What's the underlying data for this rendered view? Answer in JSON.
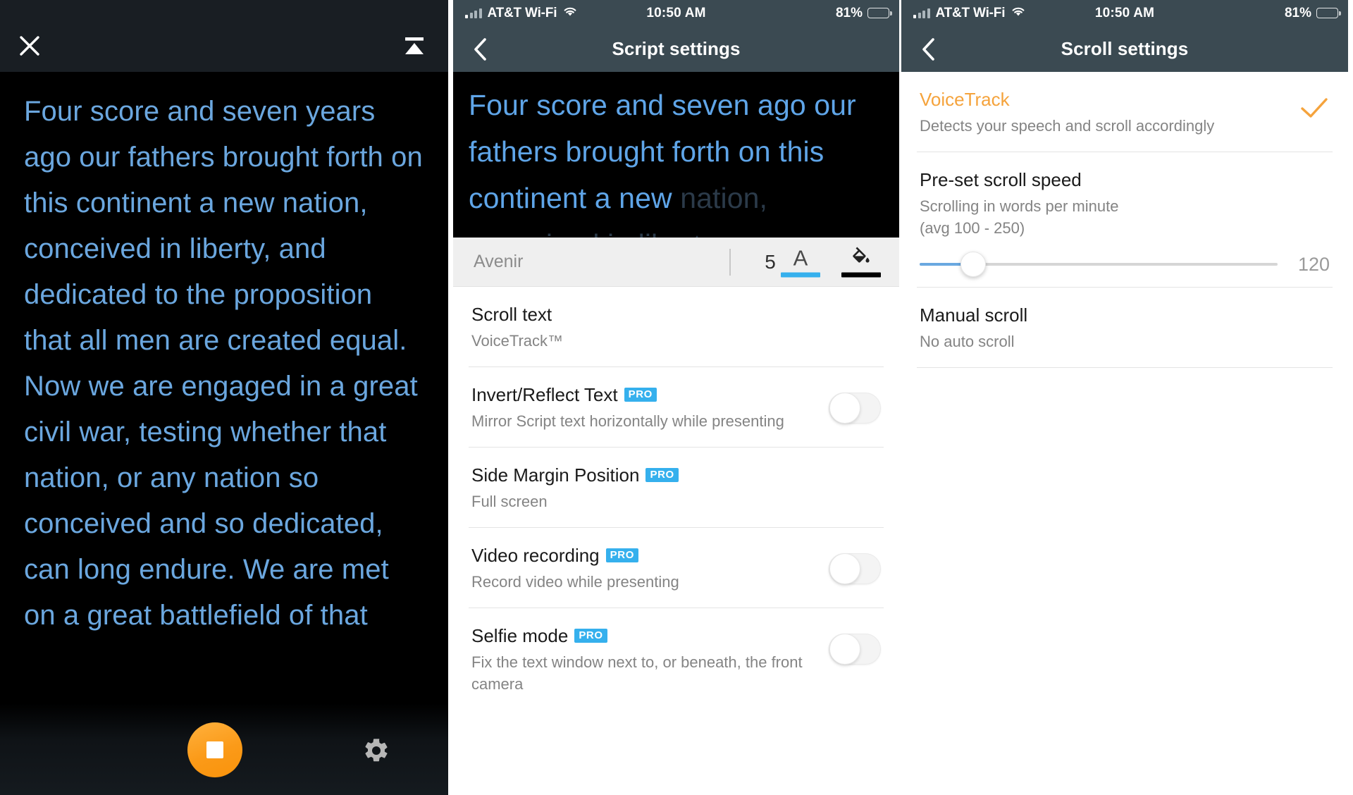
{
  "panel_teleprompter": {
    "name": "Teleprompter presenting view",
    "close_icon": "close-icon",
    "eject_icon": "eject-icon",
    "script_text": "Four score and seven years ago our fathers brought forth on this continent a new nation, conceived in liberty, and dedicated to the proposition that all men are created equal. Now we are engaged in a great civil war, testing whether that nation, or any nation so conceived and so dedicated, can long endure. We are met on a great battlefield of that",
    "record_button_label": "",
    "record_icon": "stop-square-icon",
    "settings_icon": "gear-icon",
    "accent_color": "#fb9a18",
    "text_color": "#6ba7df",
    "background_color": "#000000"
  },
  "statusbar": {
    "carrier": "AT&T Wi-Fi",
    "wifi_icon": "wifi-icon",
    "signal_icon": "signal-bars-icon",
    "time": "10:50 AM",
    "battery_percent": "81%",
    "battery_icon": "battery-icon",
    "background_color": "#3b4a52"
  },
  "panel_script_settings": {
    "nav": {
      "back_icon": "chevron-left-icon",
      "title": "Script settings"
    },
    "preview": {
      "active_text": "Four score and seven ago our fathers brought forth on this continent a new",
      "dim_text": "nation, conceived in liberty,",
      "text_color": "#5fa5e8",
      "dim_color": "#2b3a49"
    },
    "font_toolbar": {
      "font_name": "Avenir",
      "font_size": "5",
      "text_color_icon": "text-color-A-icon",
      "text_color_swatch": "#35b0ed",
      "fill_color_icon": "paint-bucket-icon",
      "fill_color_swatch": "#000000"
    },
    "rows": [
      {
        "title": "Scroll text",
        "subtitle": "VoiceTrack™",
        "pro": false,
        "control": "none"
      },
      {
        "title": "Invert/Reflect Text",
        "subtitle": "Mirror Script text horizontally while presenting",
        "pro": true,
        "pro_label": "PRO",
        "control": "toggle",
        "toggle_on": false
      },
      {
        "title": "Side Margin Position",
        "subtitle": "Full screen",
        "pro": true,
        "pro_label": "PRO",
        "control": "none"
      },
      {
        "title": "Video recording",
        "subtitle": "Record video while presenting",
        "pro": true,
        "pro_label": "PRO",
        "control": "toggle",
        "toggle_on": false
      },
      {
        "title": "Selfie mode",
        "subtitle": "Fix the text window next to, or beneath, the front camera",
        "pro": true,
        "pro_label": "PRO",
        "control": "toggle",
        "toggle_on": false
      }
    ]
  },
  "panel_scroll_settings": {
    "nav": {
      "back_icon": "chevron-left-icon",
      "title": "Scroll settings"
    },
    "rows": [
      {
        "title": "VoiceTrack",
        "subtitle": "Detects your speech and scroll accordingly",
        "selected": true,
        "check_icon": "check-icon",
        "accent_color": "#f5a33c"
      },
      {
        "title": "Pre-set scroll speed",
        "subtitle_line1": "Scrolling in words per minute",
        "subtitle_line2": "(avg 100 - 250)",
        "slider": {
          "value": "120",
          "min": 0,
          "max": 800,
          "percent": 15,
          "fill_color": "#6aa8e0",
          "track_color": "#d6d6d6"
        }
      },
      {
        "title": "Manual scroll",
        "subtitle": "No auto scroll"
      }
    ]
  }
}
